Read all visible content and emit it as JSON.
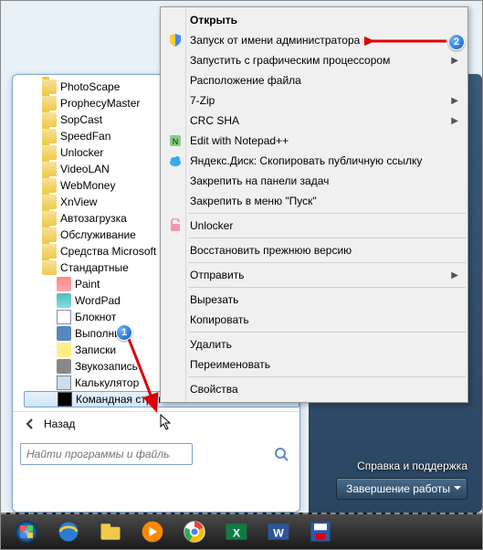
{
  "startmenu": {
    "folders": [
      "PhotoScape",
      "ProphecyMaster",
      "SopCast",
      "SpeedFan",
      "Unlocker",
      "VideoLAN",
      "WebMoney",
      "XnView",
      "Автозагрузка",
      "Обслуживание",
      "Средства Microsoft Office",
      "Стандартные"
    ],
    "apps": [
      {
        "label": "Paint",
        "cls": "ai-paint"
      },
      {
        "label": "WordPad",
        "cls": "ai-wordpad"
      },
      {
        "label": "Блокнот",
        "cls": "ai-notepad"
      },
      {
        "label": "Выполнить",
        "cls": "ai-run"
      },
      {
        "label": "Записки",
        "cls": "ai-sticky"
      },
      {
        "label": "Звукозапись",
        "cls": "ai-sound"
      },
      {
        "label": "Калькулятор",
        "cls": "ai-calc"
      },
      {
        "label": "Командная строка",
        "cls": "ai-cmd"
      }
    ],
    "back": "Назад",
    "search_placeholder": "Найти программы и файлы",
    "right_help": "Справка и поддержка",
    "shutdown": "Завершение работы"
  },
  "context": {
    "items": [
      {
        "label": "Открыть",
        "bold": true,
        "sep": false
      },
      {
        "label": "Запуск от имени администратора",
        "icon": "shield",
        "sep": false
      },
      {
        "label": "Запустить с графическим процессором",
        "expand": true,
        "sep": false
      },
      {
        "label": "Расположение файла",
        "sep": false
      },
      {
        "label": "7-Zip",
        "expand": true,
        "sep": false
      },
      {
        "label": "CRC SHA",
        "expand": true,
        "sep": false
      },
      {
        "label": "Edit with Notepad++",
        "icon": "npp",
        "sep": false
      },
      {
        "label": "Яндекс.Диск: Скопировать публичную ссылку",
        "icon": "yadisk",
        "sep": false
      },
      {
        "label": "Закрепить на панели задач",
        "sep": false
      },
      {
        "label": "Закрепить в меню \"Пуск\"",
        "sep": true
      },
      {
        "label": "Unlocker",
        "icon": "unlocker",
        "sep": true
      },
      {
        "label": "Восстановить прежнюю версию",
        "sep": true
      },
      {
        "label": "Отправить",
        "expand": true,
        "sep": true
      },
      {
        "label": "Вырезать",
        "sep": false
      },
      {
        "label": "Копировать",
        "sep": true
      },
      {
        "label": "Удалить",
        "sep": false
      },
      {
        "label": "Переименовать",
        "sep": true
      },
      {
        "label": "Свойства",
        "sep": false
      }
    ]
  },
  "badges": {
    "b1": "1",
    "b2": "2"
  }
}
